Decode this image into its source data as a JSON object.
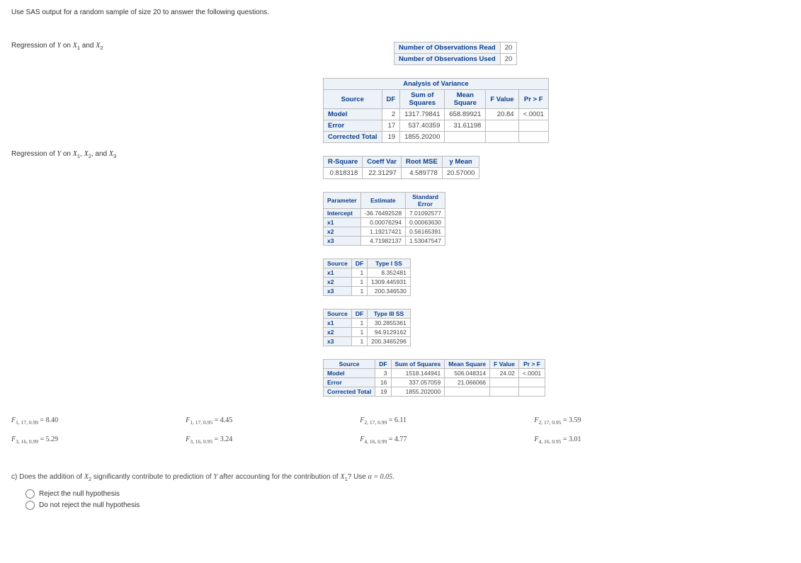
{
  "intro": "Use SAS output for a random sample of size 20 to answer the following questions.",
  "reg1_label_a": "Regression of ",
  "reg1_label_b": " on ",
  "reg1_label_c": " and ",
  "y_var": "Y",
  "x1_var": "X",
  "x2_var": "X",
  "x3_var": "X",
  "sub1": "1",
  "sub2": "2",
  "sub3": "3",
  "obs": {
    "read_label": "Number of Observations Read",
    "read_val": "20",
    "used_label": "Number of Observations Used",
    "used_val": "20"
  },
  "anova1": {
    "title": "Analysis of Variance",
    "h_source": "Source",
    "h_df": "DF",
    "h_ss": "Sum of\nSquares",
    "h_ms": "Mean\nSquare",
    "h_f": "F Value",
    "h_p": "Pr > F",
    "row_model": "Model",
    "row_error": "Error",
    "row_total": "Corrected Total",
    "m_df": "2",
    "m_ss": "1317.79841",
    "m_ms": "658.89921",
    "m_f": "20.84",
    "m_p": "<.0001",
    "e_df": "17",
    "e_ss": "537.40359",
    "e_ms": "31.61198",
    "t_df": "19",
    "t_ss": "1855.20200"
  },
  "fit": {
    "h_r2": "R-Square",
    "h_cv": "Coeff Var",
    "h_rmse": "Root MSE",
    "h_ym": "y Mean",
    "r2": "0.818318",
    "cv": "22.31297",
    "rmse": "4.589778",
    "ym": "20.57000"
  },
  "params": {
    "h_param": "Parameter",
    "h_est": "Estimate",
    "h_se": "Standard\nError",
    "int_l": "Intercept",
    "int_e": "-36.76492528",
    "int_s": "7.01092577",
    "x1_l": "x1",
    "x1_e": "0.00076294",
    "x1_s": "0.00063630",
    "x2_l": "x2",
    "x2_e": "1.19217421",
    "x2_s": "0.56165391",
    "x3_l": "x3",
    "x3_e": "4.71982137",
    "x3_s": "1.53047547"
  },
  "t1": {
    "h_src": "Source",
    "h_df": "DF",
    "h_ss": "Type I SS",
    "x1_df": "1",
    "x1_ss": "8.352481",
    "x2_df": "1",
    "x2_ss": "1309.445931",
    "x3_df": "1",
    "x3_ss": "200.346530"
  },
  "t3": {
    "h_src": "Source",
    "h_df": "DF",
    "h_ss": "Type III SS",
    "x1_df": "1",
    "x1_ss": "30.2855361",
    "x2_df": "1",
    "x2_ss": "94.9129162",
    "x3_df": "1",
    "x3_ss": "200.3465296"
  },
  "anova2": {
    "h_src": "Source",
    "h_df": "DF",
    "h_ss": "Sum of Squares",
    "h_ms": "Mean Square",
    "h_f": "F Value",
    "h_p": "Pr > F",
    "m_l": "Model",
    "m_df": "3",
    "m_ss": "1518.144941",
    "m_ms": "506.048314",
    "m_f": "24.02",
    "m_p": "<.0001",
    "e_l": "Error",
    "e_df": "16",
    "e_ss": "337.057059",
    "e_ms": "21.066066",
    "t_l": "Corrected Total",
    "t_df": "19",
    "t_ss": "1855.202000"
  },
  "fvals": {
    "f1": "= 8.40",
    "f2": "= 4.45",
    "f3": "= 6.11",
    "f4": "= 3.59",
    "f5": "= 5.29",
    "f6": "= 3.24",
    "f7": "= 4.77",
    "f8": "= 3.01",
    "s1": "1, 17, 0.99",
    "s2": "1, 17, 0.95",
    "s3": "2, 17, 0.99",
    "s4": "2, 17, 0.95",
    "s5": "3, 16, 0.99",
    "s6": "3, 16, 0.95",
    "s7": "4, 16, 0.99",
    "s8": "4, 16, 0.95"
  },
  "qc": {
    "prefix": "c) Does the addition of ",
    "mid1": " significantly contribute to prediction of ",
    "mid2": " after accounting for the contribution of ",
    "suffix": "? Use ",
    "alpha_eq": "α = 0.05",
    "period": ".",
    "opt1": "Reject the null hypothesis",
    "opt2": "Do not reject the null hypothesis"
  }
}
